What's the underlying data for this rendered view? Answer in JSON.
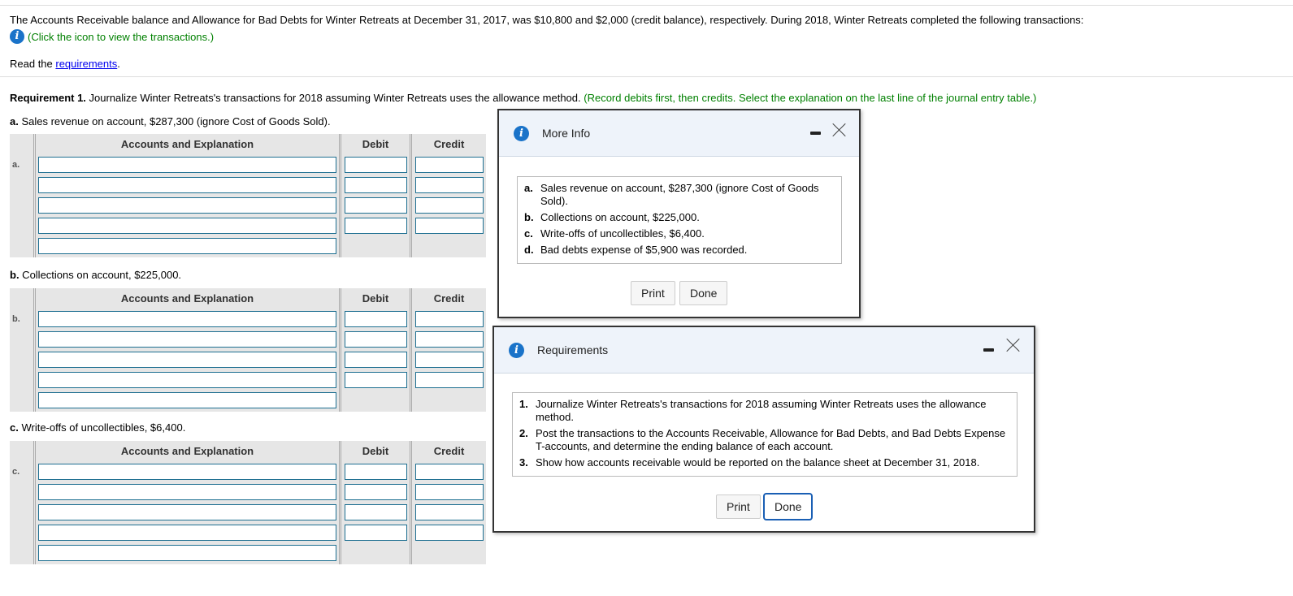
{
  "intro": {
    "text": "The Accounts Receivable balance and Allowance for Bad Debts for Winter Retreats at December 31, 2017, was $10,800 and $2,000 (credit balance), respectively. During 2018, Winter Retreats completed the following transactions:",
    "click_icon_text": "(Click the icon to view the transactions.)",
    "read_prefix": "Read the ",
    "requirements_link": "requirements",
    "read_suffix": "."
  },
  "requirement1": {
    "label": "Requirement 1.",
    "text": " Journalize Winter Retreats's transactions for 2018 assuming Winter Retreats uses the allowance method. ",
    "instruction": "(Record debits first, then credits. Select the explanation on the last line of the journal entry table.)"
  },
  "journal": {
    "headers": {
      "account": "Accounts and Explanation",
      "debit": "Debit",
      "credit": "Credit"
    },
    "sections": [
      {
        "letter_bold": "a.",
        "text": " Sales revenue on account, $287,300 (ignore Cost of Goods Sold).",
        "row_letter": "a."
      },
      {
        "letter_bold": "b.",
        "text": " Collections on account, $225,000.",
        "row_letter": "b."
      },
      {
        "letter_bold": "c.",
        "text": " Write-offs of uncollectibles, $6,400.",
        "row_letter": "c."
      }
    ]
  },
  "more_info_dialog": {
    "title": "More Info",
    "items": [
      {
        "label": "a.",
        "text": "Sales revenue on account, $287,300 (ignore Cost of Goods Sold)."
      },
      {
        "label": "b.",
        "text": "Collections on account, $225,000."
      },
      {
        "label": "c.",
        "text": "Write-offs of uncollectibles, $6,400."
      },
      {
        "label": "d.",
        "text": "Bad debts expense of $5,900 was recorded."
      }
    ],
    "print_label": "Print",
    "done_label": "Done"
  },
  "requirements_dialog": {
    "title": "Requirements",
    "items": [
      {
        "label": "1.",
        "text": "Journalize Winter Retreats's transactions for 2018 assuming Winter Retreats uses the allowance method."
      },
      {
        "label": "2.",
        "text": "Post the transactions to the Accounts Receivable, Allowance for Bad Debts, and Bad Debts Expense T-accounts, and determine the ending balance of each account."
      },
      {
        "label": "3.",
        "text": "Show how accounts receivable would be reported on the balance sheet at December 31, 2018."
      }
    ],
    "print_label": "Print",
    "done_label": "Done"
  },
  "colors": {
    "accent_blue": "#1a73c9",
    "instruction_green": "#008000",
    "link_blue": "#0000ee"
  },
  "icons": {
    "info": "info-circle-icon",
    "minimize": "minimize-icon",
    "close": "close-icon"
  }
}
